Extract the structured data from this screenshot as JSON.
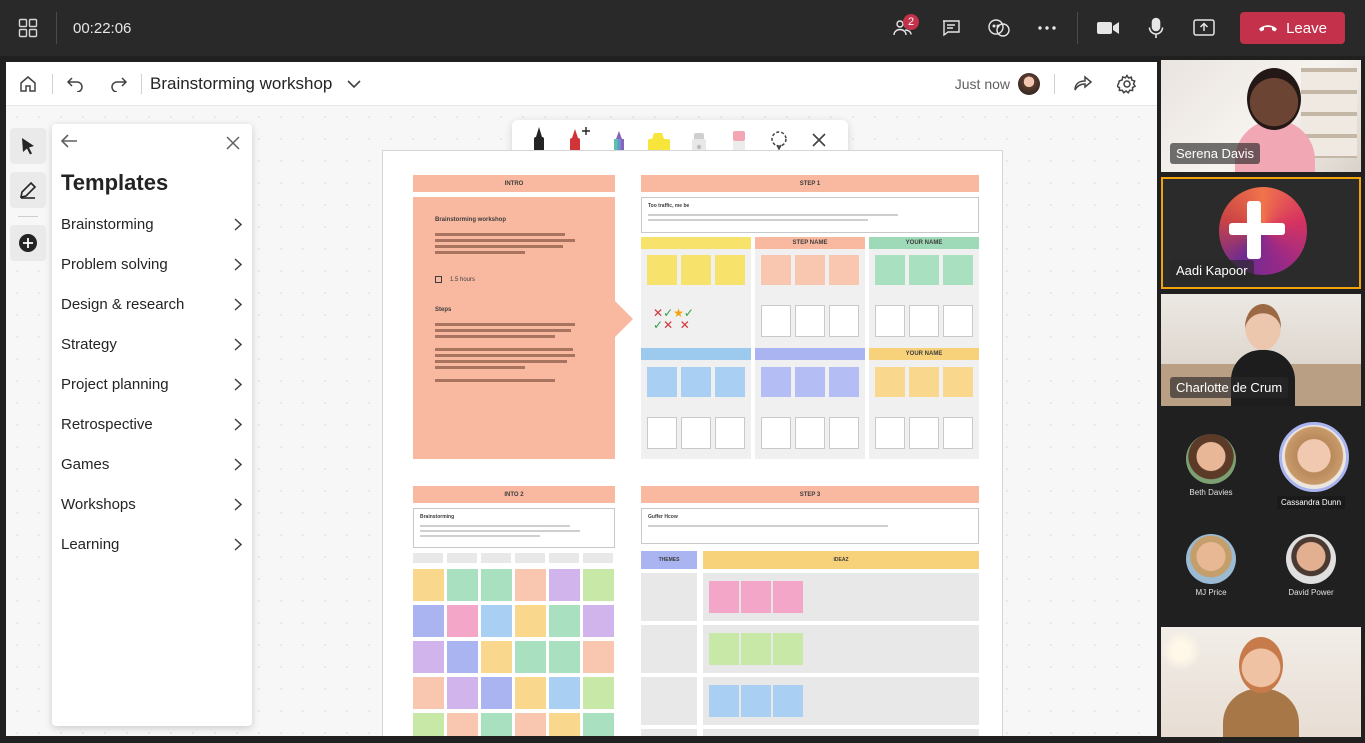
{
  "meeting": {
    "timer": "00:22:06",
    "participants_badge": "2",
    "leave_label": "Leave"
  },
  "whiteboard": {
    "title": "Brainstorming workshop",
    "saved_status": "Just now"
  },
  "templates": {
    "title": "Templates",
    "items": [
      {
        "label": "Brainstorming"
      },
      {
        "label": "Problem solving"
      },
      {
        "label": "Design & research"
      },
      {
        "label": "Strategy"
      },
      {
        "label": "Project planning"
      },
      {
        "label": "Retrospective"
      },
      {
        "label": "Games"
      },
      {
        "label": "Workshops"
      },
      {
        "label": "Learning"
      }
    ]
  },
  "board": {
    "intro_header": "INTRO",
    "intro_title": "Brainstorming workshop",
    "intro_duration": "1.5 hours",
    "intro_steps_label": "Steps",
    "step1_header": "STEP 1",
    "step1_title": "Too traffic, me be",
    "step_name": "STEP NAME",
    "your_name": "YOUR NAME",
    "intro2_header": "INTO 2",
    "intro2_title": "Brainstorming",
    "step3_header": "STEP 3",
    "step3_title": "Guffer Hcow",
    "themes_label": "THEMES",
    "ideas_label": "IDEAZ"
  },
  "participants": {
    "serena": "Serena Davis",
    "aadi": "Aadi Kapoor",
    "charlotte": "Charlotte de Crum",
    "beth": "Beth Davies",
    "cassandra": "Cassandra Dunn",
    "mj": "MJ Price",
    "david": "David Power"
  },
  "colors": {
    "leave": "#c4314b",
    "active_speaker": "#f0a30a",
    "intro_orange": "#f9b9a0"
  }
}
